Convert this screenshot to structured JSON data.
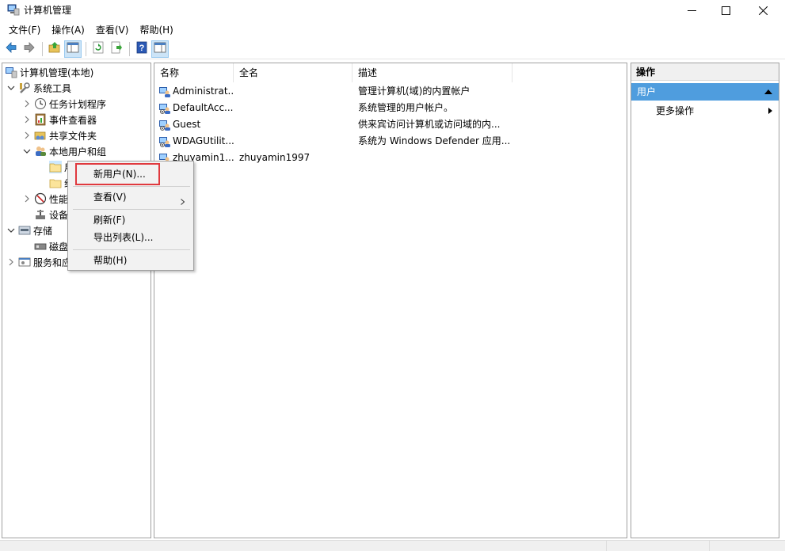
{
  "window": {
    "title": "计算机管理",
    "controls": [
      "minimize",
      "maximize",
      "close"
    ]
  },
  "menubar": {
    "items": [
      "文件(F)",
      "操作(A)",
      "查看(V)",
      "帮助(H)"
    ]
  },
  "toolbar": {
    "buttons": [
      "back-icon",
      "forward-icon",
      "up-folder-icon",
      "show-hide-tree-icon",
      "refresh-icon",
      "export-list-icon",
      "help-icon",
      "show-hide-action-pane-icon"
    ]
  },
  "tree": {
    "root": "计算机管理(本地)",
    "system_tools": "系统工具",
    "task_scheduler": "任务计划程序",
    "event_viewer": "事件查看器",
    "shared_folders": "共享文件夹",
    "local_users_groups": "本地用户和组",
    "users_folder": "用户",
    "groups_folder": "组",
    "performance": "性能",
    "device_manager": "设备管理器",
    "storage": "存储",
    "disk_management": "磁盘管理",
    "services_apps": "服务和应用程序"
  },
  "list": {
    "columns": [
      "名称",
      "全名",
      "描述"
    ],
    "rows": [
      {
        "name": "Administrat...",
        "fullname": "",
        "desc": "管理计算机(域)的内置帐户"
      },
      {
        "name": "DefaultAcc...",
        "fullname": "",
        "desc": "系统管理的用户帐户。"
      },
      {
        "name": "Guest",
        "fullname": "",
        "desc": "供来宾访问计算机或访问域的内..."
      },
      {
        "name": "WDAGUtilit...",
        "fullname": "",
        "desc": "系统为 Windows Defender 应用..."
      },
      {
        "name": "zhuyamin1...",
        "fullname": "zhuyamin1997",
        "desc": ""
      }
    ]
  },
  "actions": {
    "title": "操作",
    "group": "用户",
    "more": "更多操作"
  },
  "context_menu": {
    "new_user": "新用户(N)...",
    "view": "查看(V)",
    "refresh": "刷新(F)",
    "export": "导出列表(L)...",
    "help": "帮助(H)"
  },
  "colors": {
    "selection": "#4f9dde",
    "highlight_box": "#e0393e",
    "pressed": "#cce4f7"
  }
}
